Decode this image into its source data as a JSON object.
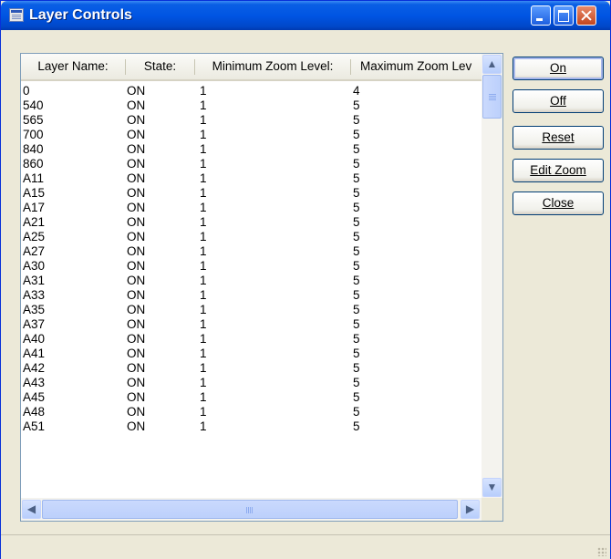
{
  "window": {
    "title": "Layer Controls"
  },
  "listview": {
    "columns": [
      "Layer Name:",
      "State:",
      "Minimum Zoom Level:",
      "Maximum Zoom Lev"
    ],
    "rows": [
      [
        "0",
        "ON",
        "1",
        "4"
      ],
      [
        "540",
        "ON",
        "1",
        "5"
      ],
      [
        "565",
        "ON",
        "1",
        "5"
      ],
      [
        "700",
        "ON",
        "1",
        "5"
      ],
      [
        "840",
        "ON",
        "1",
        "5"
      ],
      [
        "860",
        "ON",
        "1",
        "5"
      ],
      [
        "A11",
        "ON",
        "1",
        "5"
      ],
      [
        "A15",
        "ON",
        "1",
        "5"
      ],
      [
        "A17",
        "ON",
        "1",
        "5"
      ],
      [
        "A21",
        "ON",
        "1",
        "5"
      ],
      [
        "A25",
        "ON",
        "1",
        "5"
      ],
      [
        "A27",
        "ON",
        "1",
        "5"
      ],
      [
        "A30",
        "ON",
        "1",
        "5"
      ],
      [
        "A31",
        "ON",
        "1",
        "5"
      ],
      [
        "A33",
        "ON",
        "1",
        "5"
      ],
      [
        "A35",
        "ON",
        "1",
        "5"
      ],
      [
        "A37",
        "ON",
        "1",
        "5"
      ],
      [
        "A40",
        "ON",
        "1",
        "5"
      ],
      [
        "A41",
        "ON",
        "1",
        "5"
      ],
      [
        "A42",
        "ON",
        "1",
        "5"
      ],
      [
        "A43",
        "ON",
        "1",
        "5"
      ],
      [
        "A45",
        "ON",
        "1",
        "5"
      ],
      [
        "A48",
        "ON",
        "1",
        "5"
      ],
      [
        "A51",
        "ON",
        "1",
        "5"
      ]
    ]
  },
  "buttons": {
    "on": "On",
    "off": "Off",
    "reset": "Reset",
    "edit_zoom": "Edit Zoom",
    "close": "Close"
  },
  "icons": {
    "scroll_up": "▲",
    "scroll_down": "▼",
    "scroll_left": "◀",
    "scroll_right": "▶"
  },
  "colors": {
    "title_bar": "#0055e3",
    "close_button": "#c3461f",
    "window_face": "#ece9d8"
  }
}
